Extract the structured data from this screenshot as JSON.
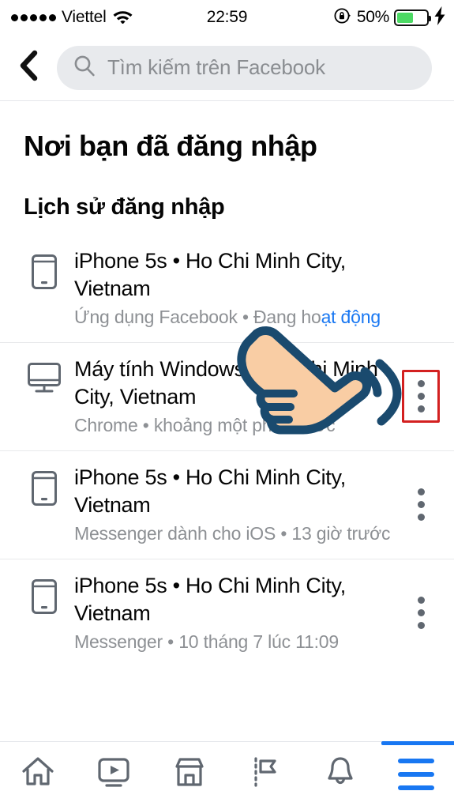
{
  "status_bar": {
    "signal_dots": 5,
    "carrier": "Viettel",
    "wifi_icon": "wifi-icon",
    "time": "22:59",
    "rotation_lock_icon": "rotation-lock-icon",
    "battery_percent_label": "50%",
    "battery_level": 50,
    "battery_fill_color": "#4cd964",
    "charging_icon": "lightning-bolt-icon"
  },
  "header": {
    "back_icon": "back-chevron-icon",
    "search_icon": "search-icon",
    "search_placeholder": "Tìm kiếm trên Facebook",
    "search_value": ""
  },
  "page": {
    "title": "Nơi bạn đã đăng nhập",
    "section_title": "Lịch sử đăng nhập"
  },
  "sessions": [
    {
      "device_icon": "mobile-phone-icon",
      "title": "iPhone 5s • Ho Chi Minh City, Vietnam",
      "subtitle_prefix": "Ứng dụng Facebook • Đang ho",
      "subtitle_active": "ạt động",
      "has_active_status": true,
      "menu_icon": "kebab-menu-icon",
      "menu_highlighted": false,
      "menu_visible": false
    },
    {
      "device_icon": "desktop-monitor-icon",
      "title": "Máy tính Windows • Ho Chi Minh City, Vietnam",
      "subtitle_prefix": "Chrome • khoảng một phút trước",
      "subtitle_active": "",
      "has_active_status": false,
      "menu_icon": "kebab-menu-icon",
      "menu_highlighted": true,
      "menu_visible": true
    },
    {
      "device_icon": "mobile-phone-icon",
      "title": "iPhone 5s • Ho Chi Minh City, Vietnam",
      "subtitle_prefix": "Messenger dành cho iOS • 13 giờ trước",
      "subtitle_active": "",
      "has_active_status": false,
      "menu_icon": "kebab-menu-icon",
      "menu_highlighted": false,
      "menu_visible": true
    },
    {
      "device_icon": "mobile-phone-icon",
      "title": "iPhone 5s • Ho Chi Minh City, Vietnam",
      "subtitle_prefix": "Messenger • 10 tháng 7 lúc 11:09",
      "subtitle_active": "",
      "has_active_status": false,
      "menu_icon": "kebab-menu-icon",
      "menu_highlighted": false,
      "menu_visible": true
    }
  ],
  "bottom_nav": {
    "items": [
      {
        "icon": "home-icon",
        "active": false
      },
      {
        "icon": "watch-video-icon",
        "active": false
      },
      {
        "icon": "marketplace-store-icon",
        "active": false
      },
      {
        "icon": "groups-flag-icon",
        "active": false
      },
      {
        "icon": "notifications-bell-icon",
        "active": false
      },
      {
        "icon": "hamburger-menu-icon",
        "active": true
      }
    ],
    "active_color": "#1877f2",
    "inactive_color": "#606770"
  },
  "overlay": {
    "hand_cursor_icon": "pointing-hand-cursor",
    "hand_fill_color": "#f9cda4",
    "hand_outline_color": "#1a4a6e",
    "highlight_box_color": "#d32020"
  }
}
